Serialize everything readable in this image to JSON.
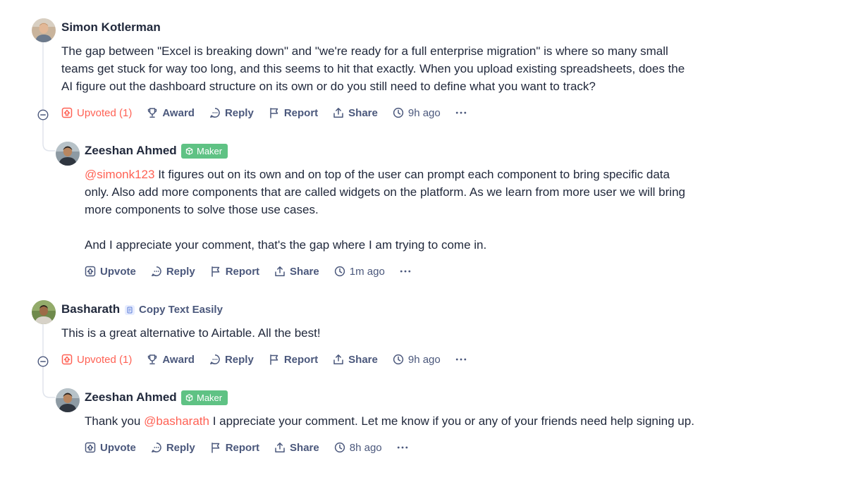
{
  "comments": [
    {
      "author": "Simon Kotlerman",
      "body_lines": [
        "The gap between \"Excel is breaking down\" and \"we're ready for a full enterprise migration\" is where so many small",
        "teams get stuck for way too long, and this seems to hit that exactly. When you upload existing spreadsheets, does the",
        "AI figure out the dashboard structure on its own or do you still need to define what you want to track?"
      ],
      "actions": {
        "upvote": "Upvoted (1)",
        "award": "Award",
        "reply": "Reply",
        "report": "Report",
        "share": "Share",
        "time": "9h ago"
      }
    },
    {
      "author": "Zeeshan Ahmed",
      "badge": "Maker",
      "mention": "@simonk123",
      "line1_rest": " It figures out on its own and on top of the user can prompt each component to bring specific data",
      "line2": "only. Also add more components that are called widgets on the platform. As we learn from more user we will bring",
      "line3": "more components to solve those use cases.",
      "line4": "And I appreciate your comment, that's the gap where I am trying to come in.",
      "actions": {
        "upvote": "Upvote",
        "reply": "Reply",
        "report": "Report",
        "share": "Share",
        "time": "1m ago"
      }
    },
    {
      "author": "Basharath",
      "product_badge": "Copy Text Easily",
      "body": "This is a great alternative to Airtable. All the best!",
      "actions": {
        "upvote": "Upvoted (1)",
        "award": "Award",
        "reply": "Reply",
        "report": "Report",
        "share": "Share",
        "time": "9h ago"
      }
    },
    {
      "author": "Zeeshan Ahmed",
      "badge": "Maker",
      "prefix": "Thank you ",
      "mention": "@basharath",
      "rest": " I appreciate your comment. Let me know if you or any of your friends need help signing up.",
      "actions": {
        "upvote": "Upvote",
        "reply": "Reply",
        "report": "Report",
        "share": "Share",
        "time": "8h ago"
      }
    }
  ],
  "colors": {
    "text": "#21293c",
    "muted": "#4b587c",
    "accent": "#ff6154",
    "maker_badge": "#5fc284"
  },
  "icons": {
    "upvote": "upvote-icon",
    "award": "trophy-icon",
    "reply": "speech-bubble-icon",
    "report": "flag-icon",
    "share": "share-icon",
    "time": "clock-icon",
    "more": "more-dots-icon",
    "collapse": "collapse-minus-icon"
  }
}
